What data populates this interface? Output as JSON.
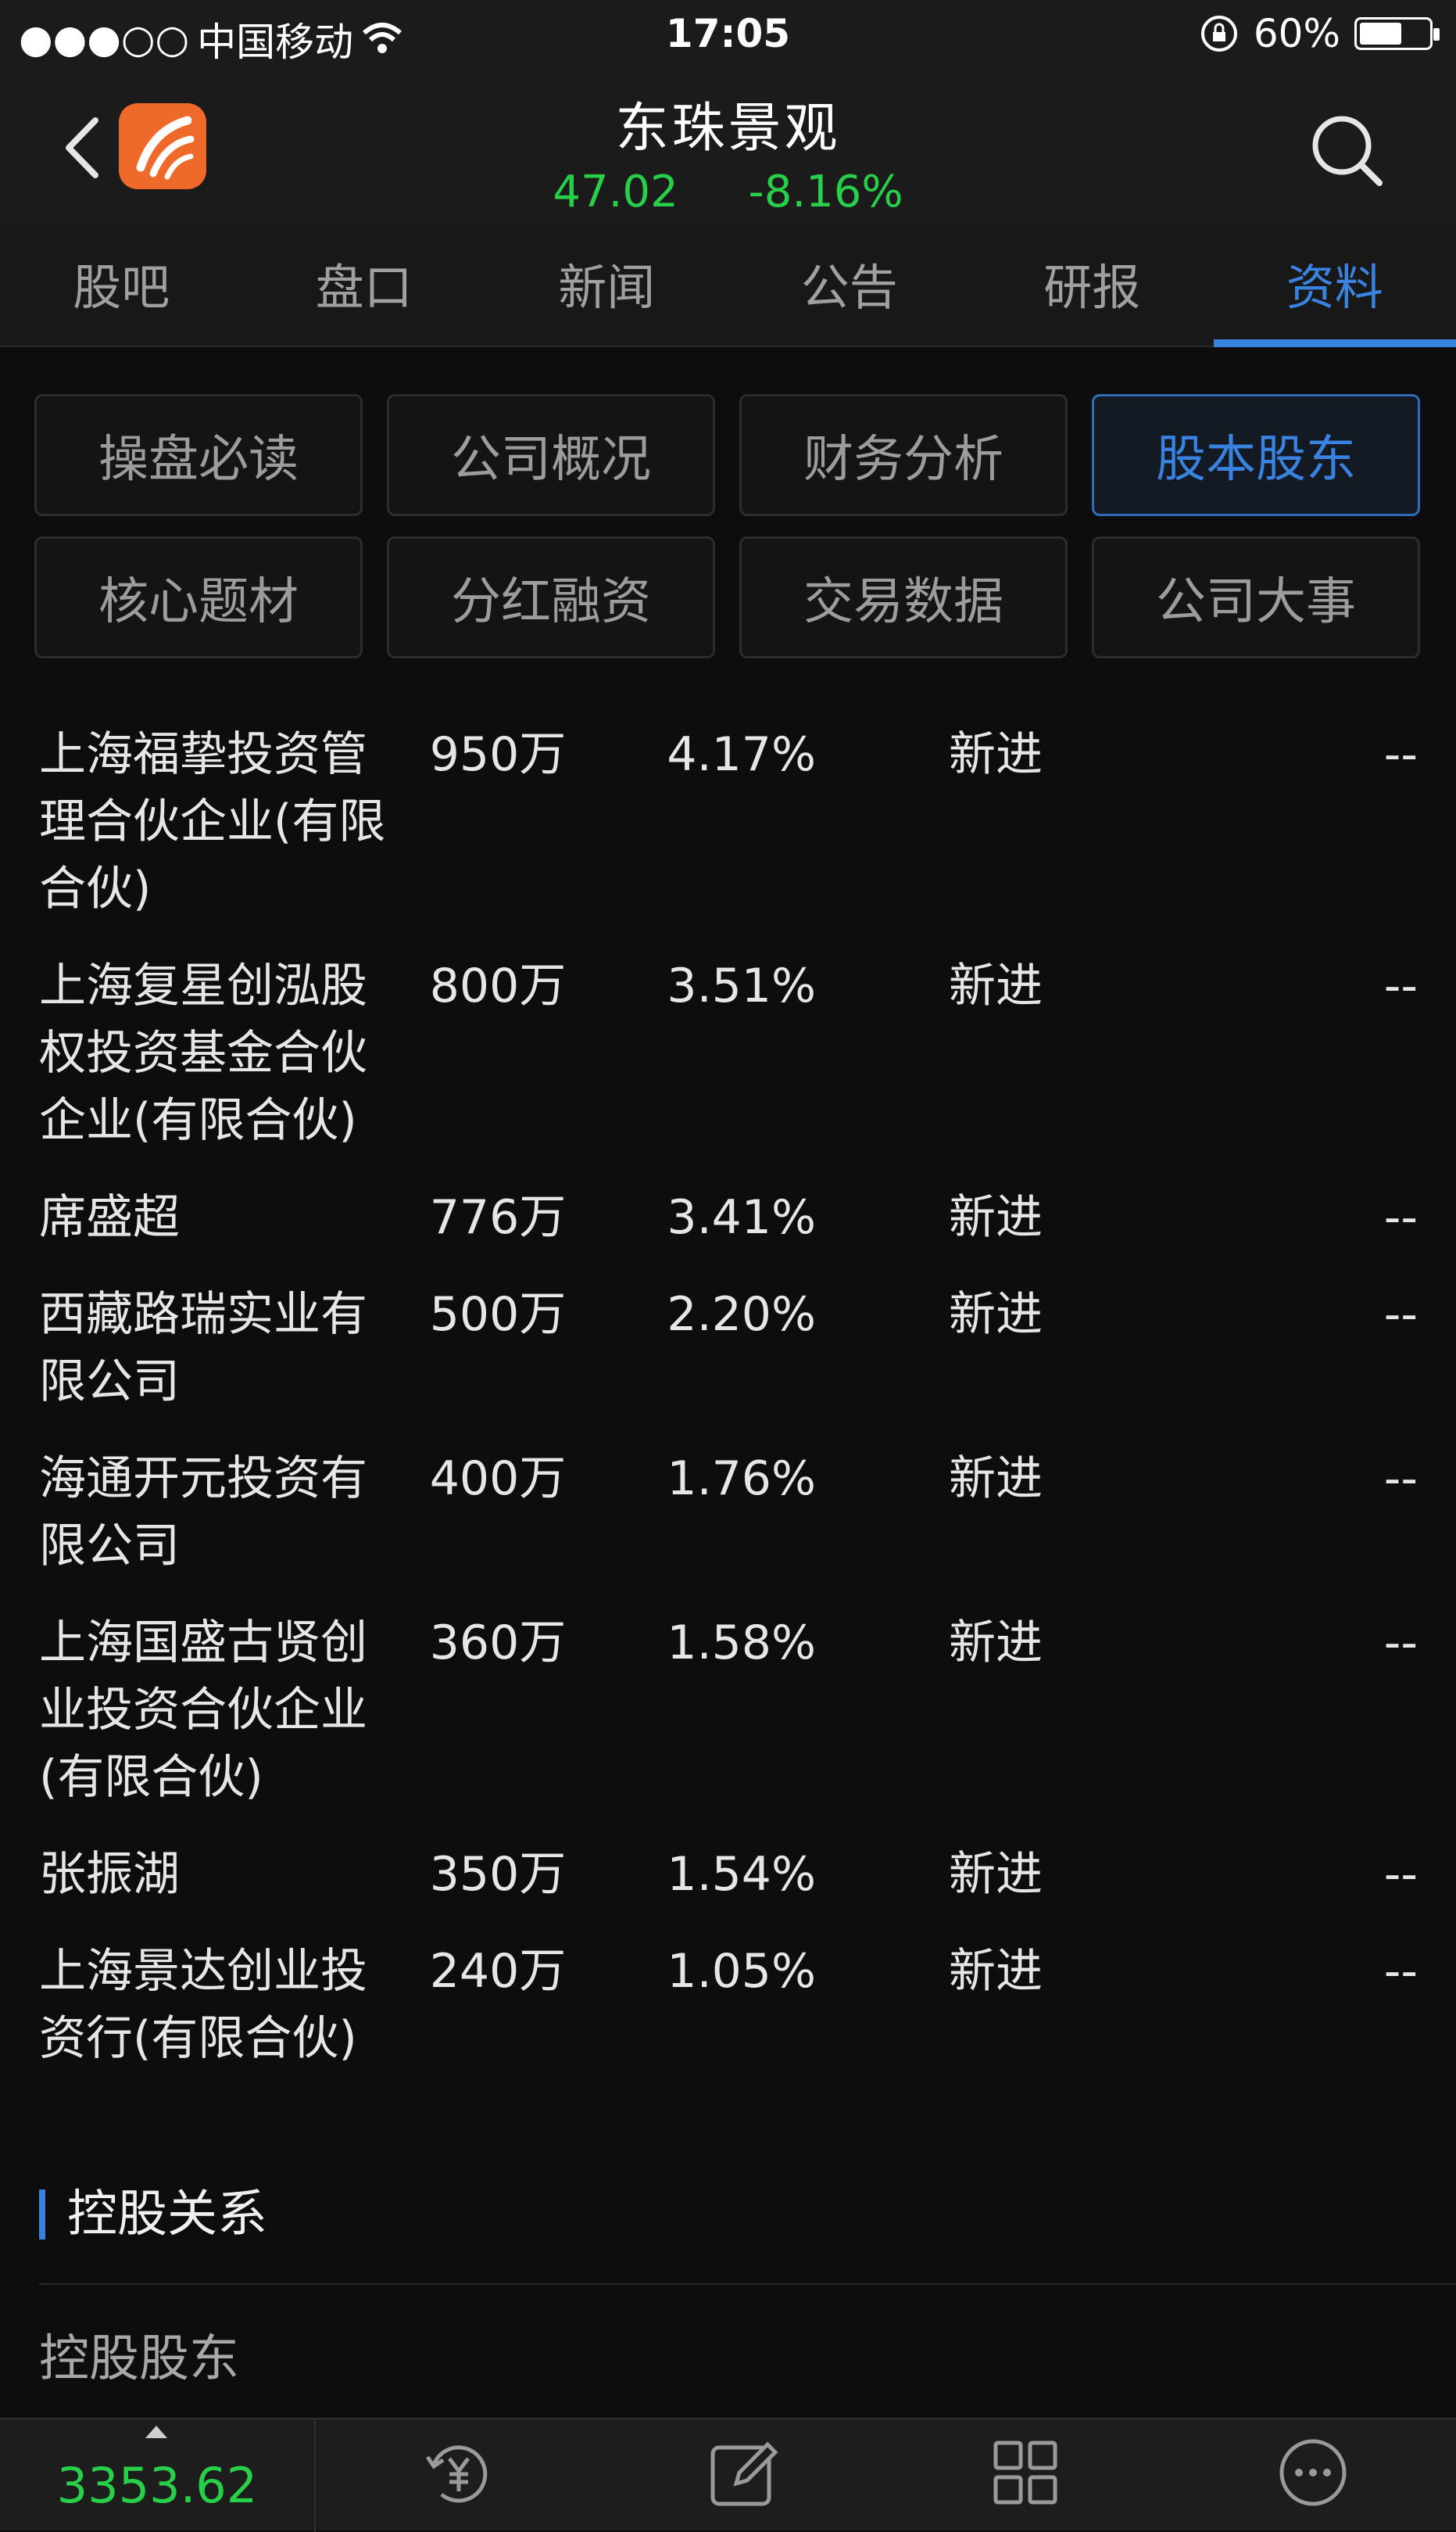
{
  "status_bar": {
    "signal_dots": "●●●○○",
    "carrier": "中国移动",
    "time": "17:05",
    "battery_percent": "60%",
    "battery_level": 0.6
  },
  "header": {
    "stock_name": "东珠景观",
    "price": "47.02",
    "change_pct": "-8.16%"
  },
  "tabs": [
    {
      "label": "股吧"
    },
    {
      "label": "盘口"
    },
    {
      "label": "新闻"
    },
    {
      "label": "公告"
    },
    {
      "label": "研报"
    },
    {
      "label": "资料",
      "active": true
    }
  ],
  "sub_buttons": [
    {
      "label": "操盘必读"
    },
    {
      "label": "公司概况"
    },
    {
      "label": "财务分析"
    },
    {
      "label": "股本股东",
      "active": true
    },
    {
      "label": "核心题材"
    },
    {
      "label": "分红融资"
    },
    {
      "label": "交易数据"
    },
    {
      "label": "公司大事"
    }
  ],
  "holders": [
    {
      "name": "上海福挚投资管理合伙企业(有限合伙)",
      "shares": "950万",
      "pct": "4.17%",
      "change": "新进",
      "delta": "--"
    },
    {
      "name": "上海复星创泓股权投资基金合伙企业(有限合伙)",
      "shares": "800万",
      "pct": "3.51%",
      "change": "新进",
      "delta": "--"
    },
    {
      "name": "席盛超",
      "shares": "776万",
      "pct": "3.41%",
      "change": "新进",
      "delta": "--"
    },
    {
      "name": "西藏路瑞实业有限公司",
      "shares": "500万",
      "pct": "2.20%",
      "change": "新进",
      "delta": "--"
    },
    {
      "name": "海通开元投资有限公司",
      "shares": "400万",
      "pct": "1.76%",
      "change": "新进",
      "delta": "--"
    },
    {
      "name": "上海国盛古贤创业投资合伙企业(有限合伙)",
      "shares": "360万",
      "pct": "1.58%",
      "change": "新进",
      "delta": "--"
    },
    {
      "name": "张振湖",
      "shares": "350万",
      "pct": "1.54%",
      "change": "新进",
      "delta": "--"
    },
    {
      "name": "上海景达创业投资行(有限合伙)",
      "shares": "240万",
      "pct": "1.05%",
      "change": "新进",
      "delta": "--"
    }
  ],
  "section": {
    "title": "控股关系",
    "sub_label": "控股股东"
  },
  "bottom_bar": {
    "index_value": "3353.62",
    "icons": [
      "trade-yuan-icon",
      "compose-icon",
      "grid-menu-icon",
      "more-icon"
    ]
  },
  "colors": {
    "accent": "#3a82e0",
    "down": "#28d04a",
    "logo": "#ef6a2a"
  }
}
